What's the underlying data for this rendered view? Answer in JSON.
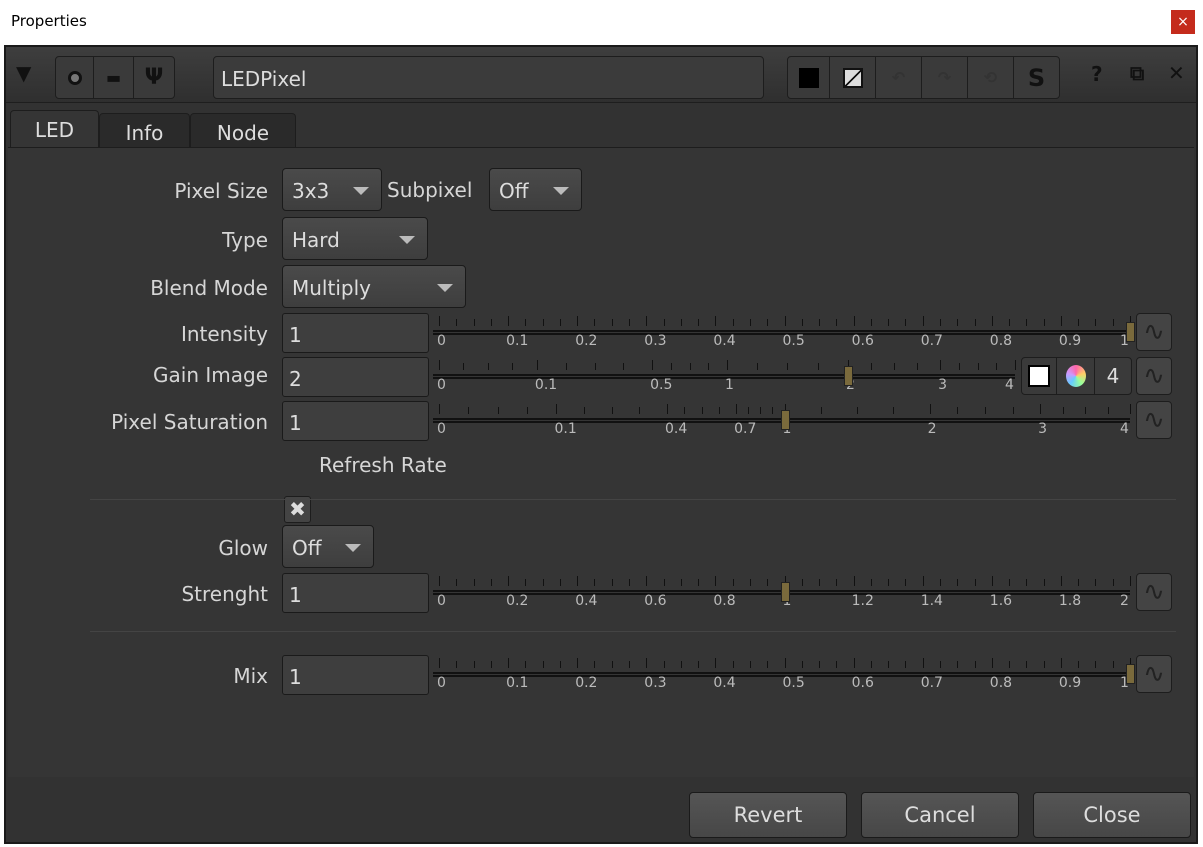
{
  "window": {
    "title": "Properties",
    "close_glyph": "×"
  },
  "header": {
    "node_name": "LEDPixel",
    "collapse_glyph": "▼",
    "s_label": "S",
    "help_glyph": "?",
    "float_glyph": "⧉",
    "close_glyph": "✕"
  },
  "tabs": [
    {
      "label": "LED",
      "active": true
    },
    {
      "label": "Info"
    },
    {
      "label": "Node"
    }
  ],
  "controls": {
    "pixel_size": {
      "label": "Pixel Size",
      "value": "3x3"
    },
    "subpixel": {
      "label": "Subpixel",
      "value": "Off"
    },
    "type": {
      "label": "Type",
      "value": "Hard"
    },
    "blend_mode": {
      "label": "Blend Mode",
      "value": "Multiply"
    },
    "intensity": {
      "label": "Intensity",
      "value": "1",
      "ticks": [
        "0",
        "0.1",
        "0.2",
        "0.3",
        "0.4",
        "0.5",
        "0.6",
        "0.7",
        "0.8",
        "0.9",
        "1"
      ],
      "slider_value": 1,
      "range": [
        0,
        1
      ]
    },
    "gain_image": {
      "label": "Gain Image",
      "value": "2",
      "ticks": [
        "0",
        "0.1",
        "0.5",
        "1",
        "2",
        "3",
        "4"
      ],
      "slider_value": 2,
      "range": [
        0,
        4
      ],
      "channels": "4"
    },
    "pixel_saturation": {
      "label": "Pixel Saturation",
      "value": "1",
      "ticks": [
        "0",
        "0.1",
        "0.4",
        "0.7",
        "1",
        "2",
        "3",
        "4"
      ],
      "slider_value": 1,
      "range": [
        0,
        4
      ]
    },
    "refresh_rate": {
      "label": "Refresh Rate",
      "checked": true,
      "glyph": "✖"
    },
    "glow": {
      "label": "Glow",
      "value": "Off"
    },
    "strength": {
      "label": "Strenght",
      "value": "1",
      "ticks": [
        "0",
        "0.2",
        "0.4",
        "0.6",
        "0.8",
        "1",
        "1.2",
        "1.4",
        "1.6",
        "1.8",
        "2"
      ],
      "slider_value": 1,
      "range": [
        0,
        2
      ]
    },
    "mix": {
      "label": "Mix",
      "value": "1",
      "ticks": [
        "0",
        "0.1",
        "0.2",
        "0.3",
        "0.4",
        "0.5",
        "0.6",
        "0.7",
        "0.8",
        "0.9",
        "1"
      ],
      "slider_value": 1,
      "range": [
        0,
        1
      ]
    }
  },
  "footer": {
    "revert": "Revert",
    "cancel": "Cancel",
    "close": "Close"
  },
  "colors": {
    "handle": "#7a6a3c",
    "background": "#353535"
  }
}
